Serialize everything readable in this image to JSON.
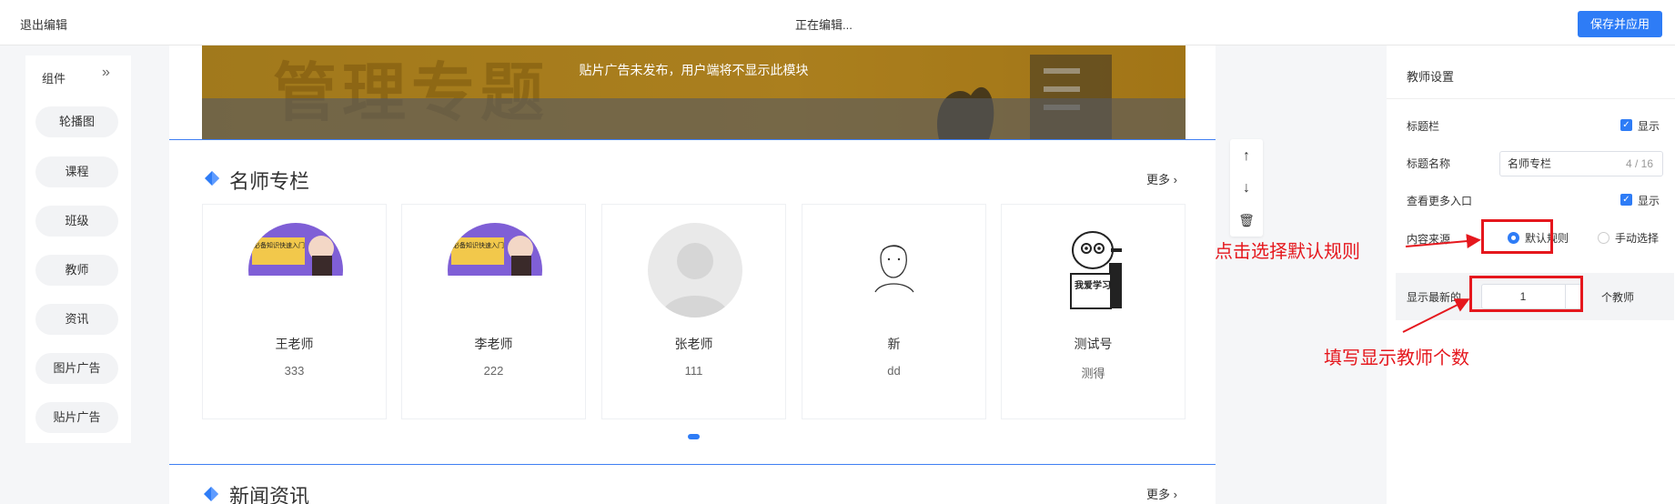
{
  "topbar": {
    "exit_label": "退出编辑",
    "status_text": "正在编辑...",
    "save_label": "保存并应用"
  },
  "components": {
    "header": "组件",
    "collapse_icon": "»",
    "items": [
      {
        "label": "轮播图"
      },
      {
        "label": "课程"
      },
      {
        "label": "班级"
      },
      {
        "label": "教师"
      },
      {
        "label": "资讯"
      },
      {
        "label": "图片广告"
      },
      {
        "label": "贴片广告"
      }
    ]
  },
  "banner": {
    "bg_text": "管理专题",
    "notice": "贴片广告未发布，用户端将不显示此模块"
  },
  "teacher_section": {
    "title": "名师专栏",
    "more": "更多 ›",
    "cards": [
      {
        "name": "王老师",
        "desc": "333",
        "avatar": "course-poster",
        "poster_text": "必备知识快速入门"
      },
      {
        "name": "李老师",
        "desc": "222",
        "avatar": "course-poster",
        "poster_text": "必备知识快速入门"
      },
      {
        "name": "张老师",
        "desc": "111",
        "avatar": "default-person"
      },
      {
        "name": "新",
        "desc": "dd",
        "avatar": "line-sketch"
      },
      {
        "name": "测试号",
        "desc": "测得",
        "avatar": "cartoon",
        "sign_text": "我爱学习"
      }
    ]
  },
  "news_section": {
    "title": "新闻资讯",
    "more": "更多 ›"
  },
  "tools": {
    "up": "↑",
    "down": "↓",
    "delete": "🗑"
  },
  "settings": {
    "title": "教师设置",
    "title_bar_label": "标题栏",
    "title_bar_check": "显示",
    "title_name_label": "标题名称",
    "title_name_value": "名师专栏",
    "title_name_count": "4 / 16",
    "more_entry_label": "查看更多入口",
    "more_entry_check": "显示",
    "source_label": "内容来源",
    "source_default": "默认规则",
    "source_manual": "手动选择",
    "latest_label": "显示最新的",
    "latest_value": "1",
    "latest_unit": "个教师"
  },
  "annotations": {
    "default_rule": "点击选择默认规则",
    "fill_count": "填写显示教师个数"
  },
  "colors": {
    "accent": "#2e7cf6",
    "annotation_red": "#e5171d"
  }
}
